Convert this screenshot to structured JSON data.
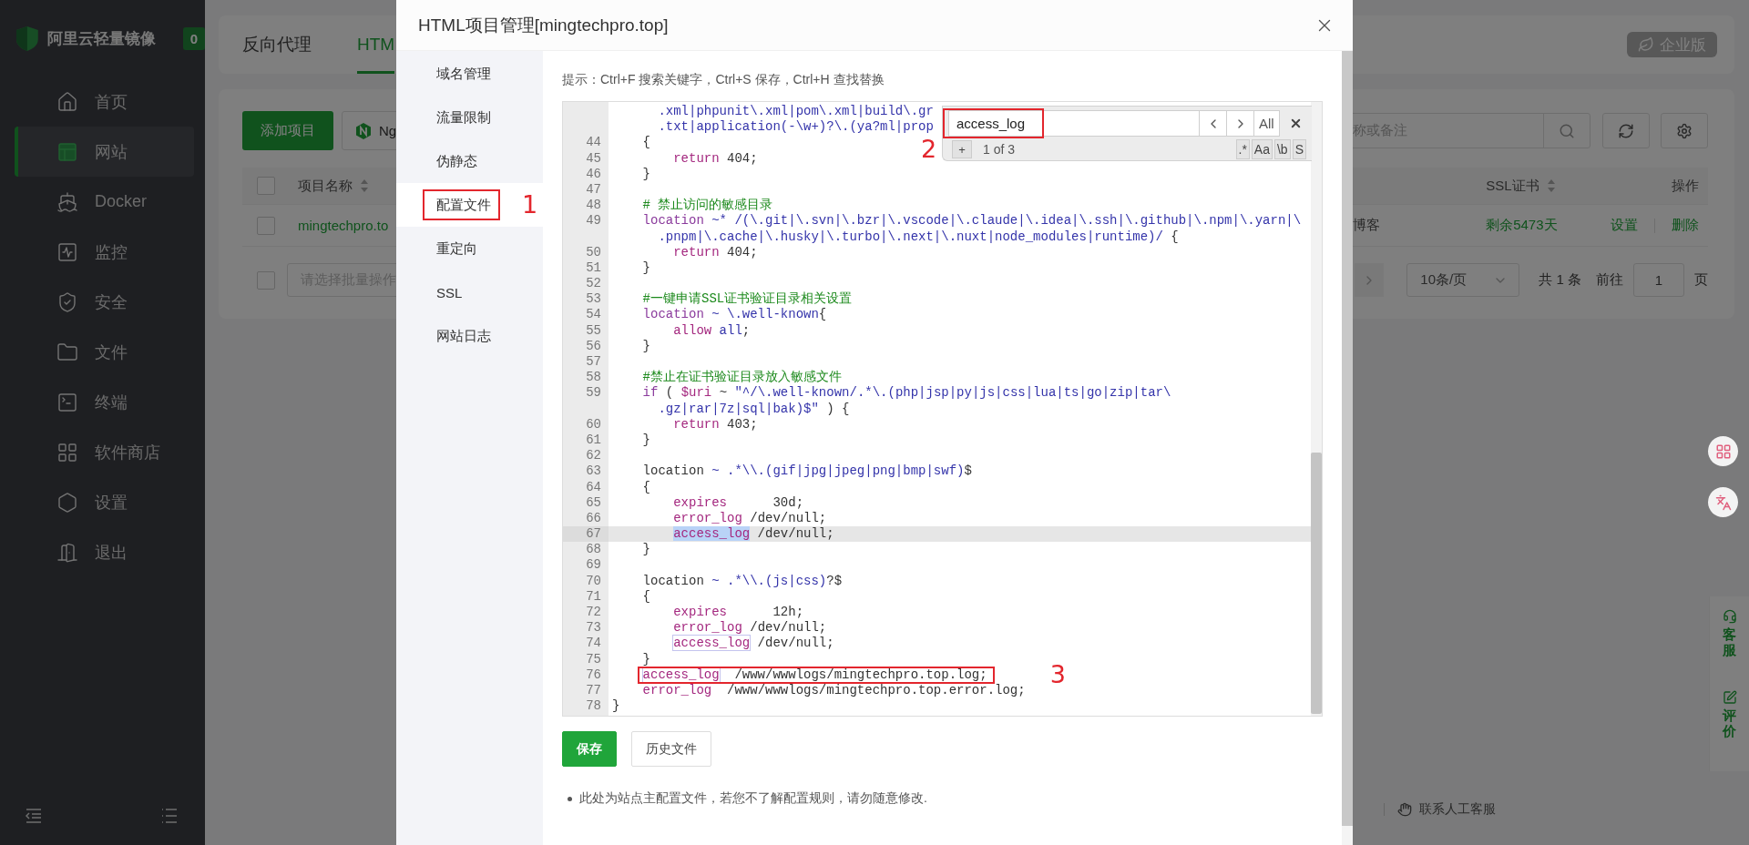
{
  "sidebar": {
    "logo": "阿里云轻量镜像",
    "badge": "0",
    "items": [
      {
        "label": "首页",
        "selected": false
      },
      {
        "label": "网站",
        "selected": true
      },
      {
        "label": "Docker",
        "selected": false
      },
      {
        "label": "监控",
        "selected": false
      },
      {
        "label": "安全",
        "selected": false
      },
      {
        "label": "文件",
        "selected": false
      },
      {
        "label": "终端",
        "selected": false
      },
      {
        "label": "软件商店",
        "selected": false
      },
      {
        "label": "设置",
        "selected": false
      },
      {
        "label": "退出",
        "selected": false
      }
    ]
  },
  "background": {
    "tabs": [
      {
        "label": "反向代理",
        "selected": false
      },
      {
        "label": "HTM",
        "selected": true
      }
    ],
    "edition": "企业版",
    "add_button": "添加项目",
    "nginx_button": "Ng",
    "search_placeholder": "称或备注",
    "table": {
      "all_checked": false,
      "left_column": {
        "label": "项目名称",
        "sortable": true
      },
      "columns": [
        {
          "label": "SSL证书",
          "sortable": true
        },
        {
          "label": "操作",
          "sortable": false
        }
      ],
      "rows": [
        {
          "checked": false,
          "name": "mingtechpro.to",
          "remark": "博客",
          "ssl": "剩余5473天",
          "actions": [
            "设置",
            "删除"
          ]
        }
      ]
    },
    "footer": {
      "batch_checked": false,
      "batch_placeholder": "请选择批量操作",
      "page_size": "10条/页",
      "total": "共 1 条",
      "goto": "前往",
      "page": "1",
      "page_unit": "页"
    },
    "side_panel": [
      {
        "label": "客服"
      },
      {
        "label": "评价"
      }
    ],
    "support_link": "联系人工客服"
  },
  "dialog": {
    "title": "HTML项目管理[mingtechpro.top]",
    "nav": [
      {
        "label": "域名管理",
        "selected": false
      },
      {
        "label": "流量限制",
        "selected": false
      },
      {
        "label": "伪静态",
        "selected": false
      },
      {
        "label": "配置文件",
        "selected": true,
        "callout": "1"
      },
      {
        "label": "重定向",
        "selected": false
      },
      {
        "label": "SSL",
        "selected": false
      },
      {
        "label": "网站日志",
        "selected": false
      }
    ],
    "hint": "提示：Ctrl+F 搜索关键字，Ctrl+S 保存，Ctrl+H 查找替换",
    "search": {
      "value": "access_log",
      "callout": "2",
      "all": "All",
      "plus": "+",
      "count": "1 of 3",
      "toggles": [
        ".*",
        "Aa",
        "\\b",
        "S"
      ]
    },
    "rows": [
      {
        "kind": "wrap",
        "active": false,
        "tokens": [
          {
            "kind": "regex",
            "text": ".xml|phpunit\\.xml|pom\\.xml|build\\.gr"
          }
        ]
      },
      {
        "kind": "wrap",
        "active": false,
        "tokens": [
          {
            "kind": "regex",
            "text": ".txt|application(-\\w+)?\\.(ya?ml|prop"
          }
        ]
      },
      {
        "number": "44",
        "kind": "block",
        "active": false,
        "tokens": [
          {
            "kind": "plain",
            "text": "{"
          }
        ]
      },
      {
        "number": "45",
        "kind": "nested",
        "active": false,
        "tokens": [
          {
            "kind": "directive",
            "text": "return"
          },
          {
            "kind": "plain",
            "text": " 404;"
          }
        ]
      },
      {
        "number": "46",
        "kind": "block",
        "active": false,
        "tokens": [
          {
            "kind": "plain",
            "text": "}"
          }
        ]
      },
      {
        "number": "47",
        "kind": "blank",
        "active": false
      },
      {
        "number": "48",
        "kind": "block",
        "active": false,
        "tokens": [
          {
            "kind": "comment",
            "text": "# 禁止访问的敏感目录"
          }
        ]
      },
      {
        "number": "49",
        "kind": "block",
        "active": false,
        "tokens": [
          {
            "kind": "keyword",
            "text": "location"
          },
          {
            "kind": "regex",
            "text": " ~* /(\\.git|\\.svn|\\.bzr|\\.vscode|\\.claude|\\.idea|\\.ssh|\\.github|\\.npm|\\.yarn|\\"
          }
        ]
      },
      {
        "kind": "wrap",
        "active": false,
        "tokens": [
          {
            "kind": "regex",
            "text": ".pnpm|\\.cache|\\.husky|\\.turbo|\\.next|\\.nuxt|node_modules|runtime)/"
          },
          {
            "kind": "plain",
            "text": " {"
          }
        ]
      },
      {
        "number": "50",
        "kind": "nested",
        "active": false,
        "tokens": [
          {
            "kind": "directive",
            "text": "return"
          },
          {
            "kind": "plain",
            "text": " 404;"
          }
        ]
      },
      {
        "number": "51",
        "kind": "block",
        "active": false,
        "tokens": [
          {
            "kind": "plain",
            "text": "}"
          }
        ]
      },
      {
        "number": "52",
        "kind": "blank",
        "active": false
      },
      {
        "number": "53",
        "kind": "block",
        "active": false,
        "tokens": [
          {
            "kind": "comment",
            "text": "#一键申请SSL证书验证目录相关设置"
          }
        ]
      },
      {
        "number": "54",
        "kind": "block",
        "active": false,
        "tokens": [
          {
            "kind": "keyword",
            "text": "location"
          },
          {
            "kind": "regex",
            "text": " ~ \\.well-known"
          },
          {
            "kind": "plain",
            "text": "{"
          }
        ]
      },
      {
        "number": "55",
        "kind": "nested",
        "active": false,
        "tokens": [
          {
            "kind": "directive",
            "text": "allow"
          },
          {
            "kind": "regex",
            "text": " all"
          },
          {
            "kind": "plain",
            "text": ";"
          }
        ]
      },
      {
        "number": "56",
        "kind": "block",
        "active": false,
        "tokens": [
          {
            "kind": "plain",
            "text": "}"
          }
        ]
      },
      {
        "number": "57",
        "kind": "blank",
        "active": false
      },
      {
        "number": "58",
        "kind": "block",
        "active": false,
        "tokens": [
          {
            "kind": "comment",
            "text": "#禁止在证书验证目录放入敏感文件"
          }
        ]
      },
      {
        "number": "59",
        "kind": "block",
        "active": false,
        "tokens": [
          {
            "kind": "keyword",
            "text": "if"
          },
          {
            "kind": "plain",
            "text": " ( "
          },
          {
            "kind": "variable",
            "text": "$uri"
          },
          {
            "kind": "plain",
            "text": " ~ "
          },
          {
            "kind": "regex",
            "text": "\"^/\\.well-known/.*\\.(php|jsp|py|js|css|lua|ts|go|zip|tar\\"
          }
        ]
      },
      {
        "kind": "wrap",
        "active": false,
        "tokens": [
          {
            "kind": "regex",
            "text": ".gz|rar|7z|sql|bak)$\""
          },
          {
            "kind": "plain",
            "text": " ) {"
          }
        ]
      },
      {
        "number": "60",
        "kind": "nested",
        "active": false,
        "tokens": [
          {
            "kind": "directive",
            "text": "return"
          },
          {
            "kind": "plain",
            "text": " 403;"
          }
        ]
      },
      {
        "number": "61",
        "kind": "block",
        "active": false,
        "tokens": [
          {
            "kind": "plain",
            "text": "}"
          }
        ]
      },
      {
        "number": "62",
        "kind": "blank",
        "active": false
      },
      {
        "number": "63",
        "kind": "block",
        "active": false,
        "tokens": [
          {
            "kind": "plain",
            "text": "location"
          },
          {
            "kind": "regex",
            "text": " ~ .*\\\\.(gif|jpg|jpeg|png|bmp|swf)"
          },
          {
            "kind": "plain",
            "text": "$"
          }
        ]
      },
      {
        "number": "64",
        "kind": "block",
        "active": false,
        "tokens": [
          {
            "kind": "plain",
            "text": "{"
          }
        ]
      },
      {
        "number": "65",
        "kind": "nested",
        "active": false,
        "tokens": [
          {
            "kind": "directive",
            "text": "expires"
          },
          {
            "kind": "plain",
            "text": "      30d;"
          }
        ]
      },
      {
        "number": "66",
        "kind": "nested",
        "active": false,
        "tokens": [
          {
            "kind": "directive",
            "text": "error_log"
          },
          {
            "kind": "plain",
            "text": " /dev/null;"
          }
        ]
      },
      {
        "number": "67",
        "kind": "nested",
        "active": true,
        "tokens": [
          {
            "kind": "current-match",
            "text": "access_log"
          },
          {
            "kind": "plain",
            "text": " /dev/null;"
          }
        ]
      },
      {
        "number": "68",
        "kind": "block",
        "active": false,
        "tokens": [
          {
            "kind": "plain",
            "text": "}"
          }
        ]
      },
      {
        "number": "69",
        "kind": "blank",
        "active": false
      },
      {
        "number": "70",
        "kind": "block",
        "active": false,
        "tokens": [
          {
            "kind": "plain",
            "text": "location"
          },
          {
            "kind": "regex",
            "text": " ~ .*\\\\.(js|css)"
          },
          {
            "kind": "plain",
            "text": "?$"
          }
        ]
      },
      {
        "number": "71",
        "kind": "block",
        "active": false,
        "tokens": [
          {
            "kind": "plain",
            "text": "{"
          }
        ]
      },
      {
        "number": "72",
        "kind": "nested",
        "active": false,
        "tokens": [
          {
            "kind": "directive",
            "text": "expires"
          },
          {
            "kind": "plain",
            "text": "      12h;"
          }
        ]
      },
      {
        "number": "73",
        "kind": "nested",
        "active": false,
        "tokens": [
          {
            "kind": "directive",
            "text": "error_log"
          },
          {
            "kind": "plain",
            "text": " /dev/null;"
          }
        ]
      },
      {
        "number": "74",
        "kind": "nested",
        "active": false,
        "tokens": [
          {
            "kind": "match",
            "text": "access_log"
          },
          {
            "kind": "plain",
            "text": " /dev/null;"
          }
        ]
      },
      {
        "number": "75",
        "kind": "block",
        "active": false,
        "tokens": [
          {
            "kind": "plain",
            "text": "}"
          }
        ]
      },
      {
        "number": "76",
        "kind": "block",
        "active": false,
        "callout": "3",
        "tokens": [
          {
            "kind": "match",
            "text": "access_log"
          },
          {
            "kind": "plain",
            "text": "  /www/wwwlogs/mingtechpro.top.log;"
          }
        ]
      },
      {
        "number": "77",
        "kind": "block",
        "active": false,
        "tokens": [
          {
            "kind": "directive",
            "text": "error_log"
          },
          {
            "kind": "plain",
            "text": "  /www/wwwlogs/mingtechpro.top.error.log;"
          }
        ]
      },
      {
        "number": "78",
        "kind": "root",
        "active": false,
        "tokens": [
          {
            "kind": "plain",
            "text": "}"
          }
        ]
      }
    ],
    "buttons": [
      {
        "label": "保存",
        "kind": "primary"
      },
      {
        "label": "历史文件",
        "kind": "default"
      }
    ],
    "notes": [
      "此处为站点主配置文件，若您不了解配置规则，请勿随意修改."
    ]
  }
}
